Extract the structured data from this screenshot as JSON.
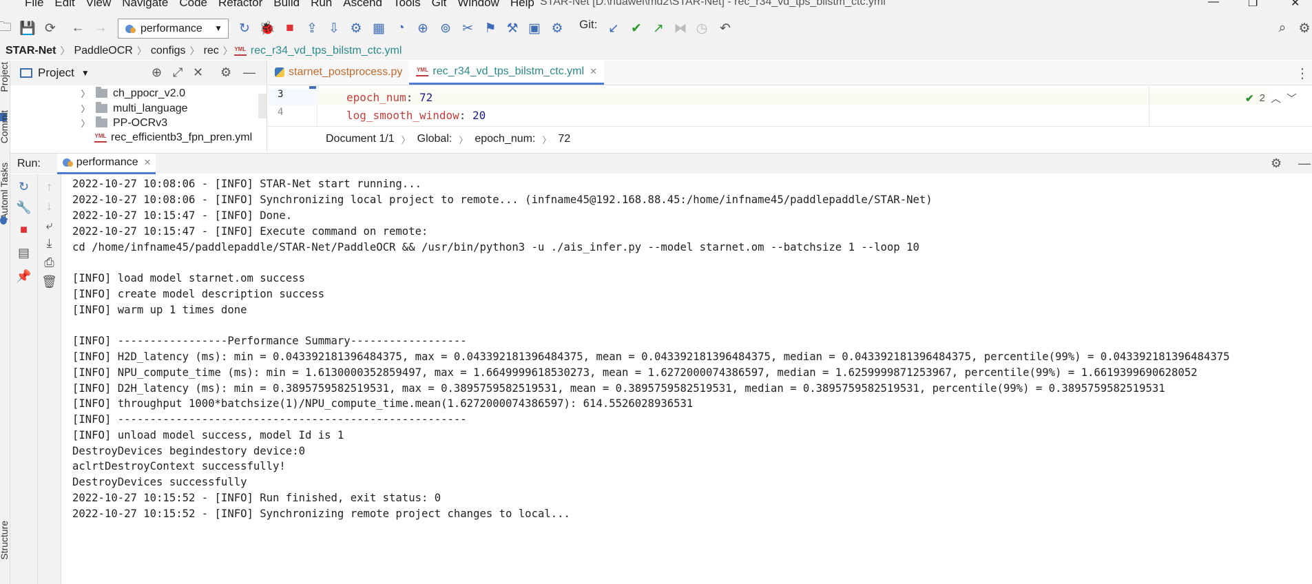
{
  "window": {
    "title": "STAR-Net [D:\\huawei\\md2\\STAR-Net] - rec_r34_vd_tps_bilstm_ctc.yml"
  },
  "menu": [
    "File",
    "Edit",
    "View",
    "Navigate",
    "Code",
    "Refactor",
    "Build",
    "Run",
    "Ascend",
    "Tools",
    "Git",
    "Window",
    "Help"
  ],
  "toolbar": {
    "run_config": "performance",
    "git_label": "Git:"
  },
  "breadcrumb": [
    "STAR-Net",
    "PaddleOCR",
    "configs",
    "rec",
    "rec_r34_vd_tps_bilstm_ctc.yml"
  ],
  "sidebar": {
    "project_tab": "Project",
    "commit_tab": "Commit",
    "automl_tab": "Automl Tasks",
    "structure_tab": "Structure"
  },
  "project": {
    "title": "Project",
    "items": [
      {
        "label": "ch_ppocr_v2.0",
        "type": "folder"
      },
      {
        "label": "multi_language",
        "type": "folder"
      },
      {
        "label": "PP-OCRv3",
        "type": "folder"
      },
      {
        "label": "rec_efficientb3_fpn_pren.yml",
        "type": "yml"
      }
    ]
  },
  "editor": {
    "tabs": [
      {
        "label": "starnet_postprocess.py",
        "active": false
      },
      {
        "label": "rec_r34_vd_tps_bilstm_ctc.yml",
        "active": true
      }
    ],
    "lines": [
      {
        "num": "3",
        "key": "epoch_num",
        "value": "72"
      },
      {
        "num": "4",
        "key": "log_smooth_window",
        "value": "20"
      }
    ],
    "inspection_count": "2",
    "status_breadcrumb": [
      "Document 1/1",
      "Global:",
      "epoch_num:",
      "72"
    ]
  },
  "run": {
    "label": "Run:",
    "tab": "performance",
    "console": [
      "2022-10-27 10:08:06 - [INFO] STAR-Net start running...",
      "2022-10-27 10:08:06 - [INFO] Synchronizing local project to remote... (infname45@192.168.88.45:/home/infname45/paddlepaddle/STAR-Net)",
      "2022-10-27 10:15:47 - [INFO] Done.",
      "2022-10-27 10:15:47 - [INFO] Execute command on remote:",
      "cd /home/infname45/paddlepaddle/STAR-Net/PaddleOCR && /usr/bin/python3 -u ./ais_infer.py --model starnet.om --batchsize 1 --loop 10",
      "",
      "[INFO] load model starnet.om success",
      "[INFO] create model description success",
      "[INFO] warm up 1 times done",
      "",
      "[INFO] -----------------Performance Summary------------------",
      "[INFO] H2D_latency (ms): min = 0.043392181396484375, max = 0.043392181396484375, mean = 0.043392181396484375, median = 0.043392181396484375, percentile(99%) = 0.043392181396484375",
      "[INFO] NPU_compute_time (ms): min = 1.6130000352859497, max = 1.6649999618530273, mean = 1.6272000074386597, median = 1.6259999871253967, percentile(99%) = 1.6619399690628052",
      "[INFO] D2H_latency (ms): min = 0.3895759582519531, max = 0.3895759582519531, mean = 0.3895759582519531, median = 0.3895759582519531, percentile(99%) = 0.3895759582519531",
      "[INFO] throughput 1000*batchsize(1)/NPU_compute_time.mean(1.6272000074386597): 614.5526028936531",
      "[INFO] ------------------------------------------------------",
      "[INFO] unload model success, model Id is 1",
      "DestroyDevices begindestory device:0",
      "aclrtDestroyContext successfully!",
      "DestroyDevices successfully",
      "2022-10-27 10:15:52 - [INFO] Run finished, exit status: 0",
      "2022-10-27 10:15:52 - [INFO] Synchronizing remote project changes to local..."
    ]
  }
}
